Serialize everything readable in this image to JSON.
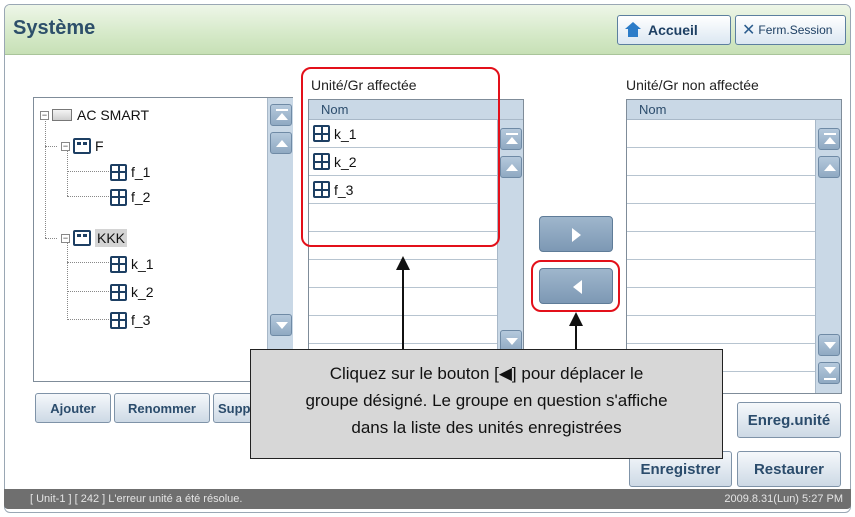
{
  "header": {
    "title": "Système",
    "home_label": "Accueil",
    "logout_label": "Ferm.Session"
  },
  "tree": {
    "root": "AC SMART",
    "groups": [
      {
        "name": "F",
        "units": [
          "f_1",
          "f_2"
        ]
      },
      {
        "name": "KKK",
        "units": [
          "k_1",
          "k_2",
          "f_3"
        ]
      }
    ]
  },
  "assigned": {
    "title": "Unité/Gr affectée",
    "column": "Nom",
    "rows": [
      "k_1",
      "k_2",
      "f_3"
    ]
  },
  "unassigned": {
    "title": "Unité/Gr non affectée",
    "column": "Nom",
    "rows": []
  },
  "buttons": {
    "add": "Ajouter",
    "rename": "Renommer",
    "delete": "Suppr",
    "save_unit": "Enreg.unité",
    "save": "Enregistrer",
    "restore": "Restaurer"
  },
  "callout": {
    "line1": "Cliquez sur le bouton [◀] pour déplacer le",
    "line2": "groupe désigné. Le groupe en question s'affiche",
    "line3": "dans la liste des unités enregistrées"
  },
  "status": {
    "message": "[ Unit-1 ] [ 242 ] L'erreur unité a été résolue.",
    "datetime": "2009.8.31(Lun)  5:27 PM"
  },
  "colors": {
    "accent_red": "#e3101a",
    "header_green": "#d5e9c8",
    "title_blue": "#2d4f6a"
  }
}
